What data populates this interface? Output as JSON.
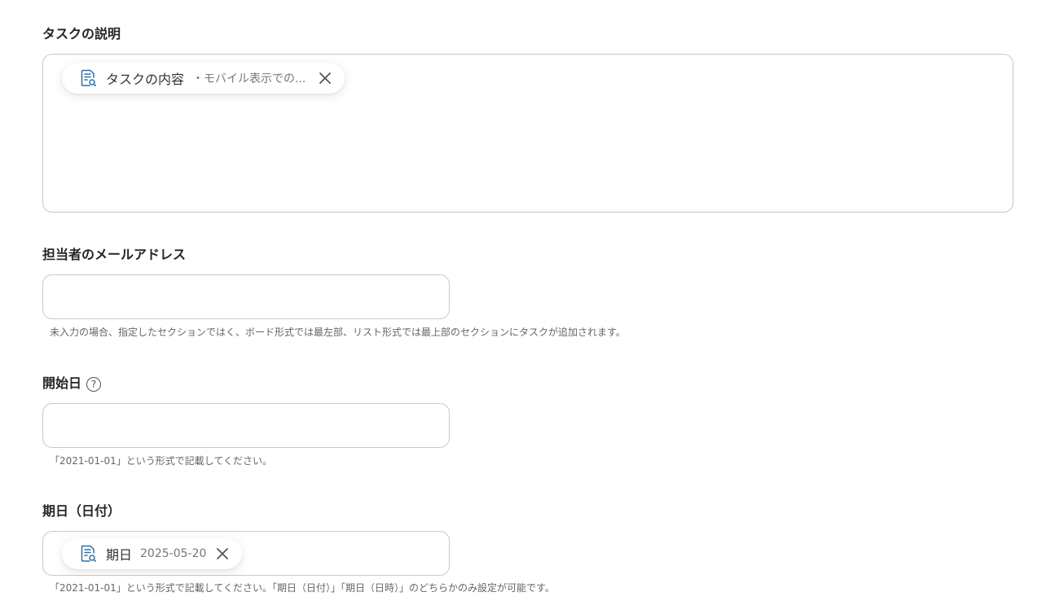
{
  "description_field": {
    "label": "タスクの説明",
    "chip": {
      "label": "タスクの内容",
      "value": "・モバイル表示での..."
    }
  },
  "assignee_field": {
    "label": "担当者のメールアドレス",
    "value": "",
    "hint": "未入力の場合、指定したセクションではく、ボード形式では最左部、リスト形式では最上部のセクションにタスクが追加されます。"
  },
  "start_date_field": {
    "label": "開始日",
    "help": "?",
    "value": "",
    "hint": "「2021-01-01」という形式で記載してください。"
  },
  "due_date_field": {
    "label": "期日（日付）",
    "chip": {
      "label": "期日",
      "value": "2025-05-20"
    },
    "hint": "「2021-01-01」という形式で記載してください。「期日（日付）」「期日（日時）」のどちらかのみ設定が可能です。"
  },
  "colors": {
    "border": "#c9c9c9",
    "icon_accent": "#2f6fa8"
  }
}
